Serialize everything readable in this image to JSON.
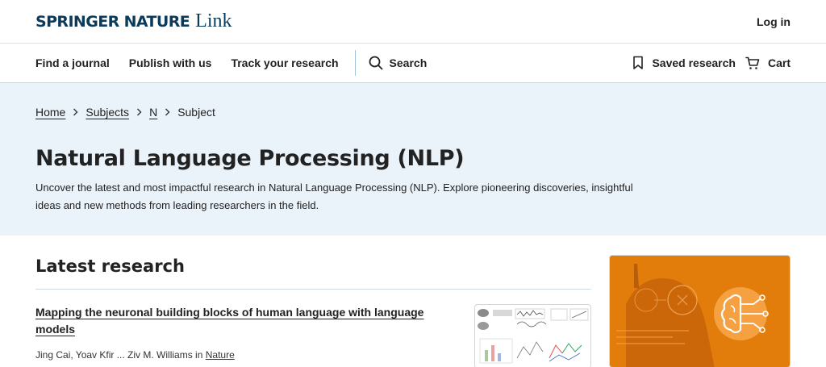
{
  "header": {
    "logo_brand": "SPRINGER NATURE",
    "logo_product": "Link",
    "login_label": "Log in"
  },
  "nav": {
    "links": [
      "Find a journal",
      "Publish with us",
      "Track your research"
    ],
    "search_label": "Search",
    "saved_label": "Saved research",
    "cart_label": "Cart"
  },
  "breadcrumb": [
    "Home",
    "Subjects",
    "N",
    "Subject"
  ],
  "hero": {
    "title": "Natural Language Processing (NLP)",
    "description": "Uncover the latest and most impactful research in Natural Language Processing (NLP). Explore pioneering discoveries, insightful ideas and new methods from leading researchers in the field."
  },
  "latest": {
    "heading": "Latest research",
    "articles": [
      {
        "title": "Mapping the neuronal building blocks of human language with language models",
        "authors": "Jing Cai, Yoav Kfir ... Ziv M. Williams in",
        "journal": "Nature"
      }
    ]
  },
  "colors": {
    "brand_navy": "#0b3a5a",
    "hero_bg": "#eaf2fa",
    "promo_orange": "#e8820e"
  },
  "icons": [
    "search-icon",
    "bookmark-icon",
    "cart-icon",
    "chevron-right-icon",
    "brain-circuit-icon"
  ]
}
